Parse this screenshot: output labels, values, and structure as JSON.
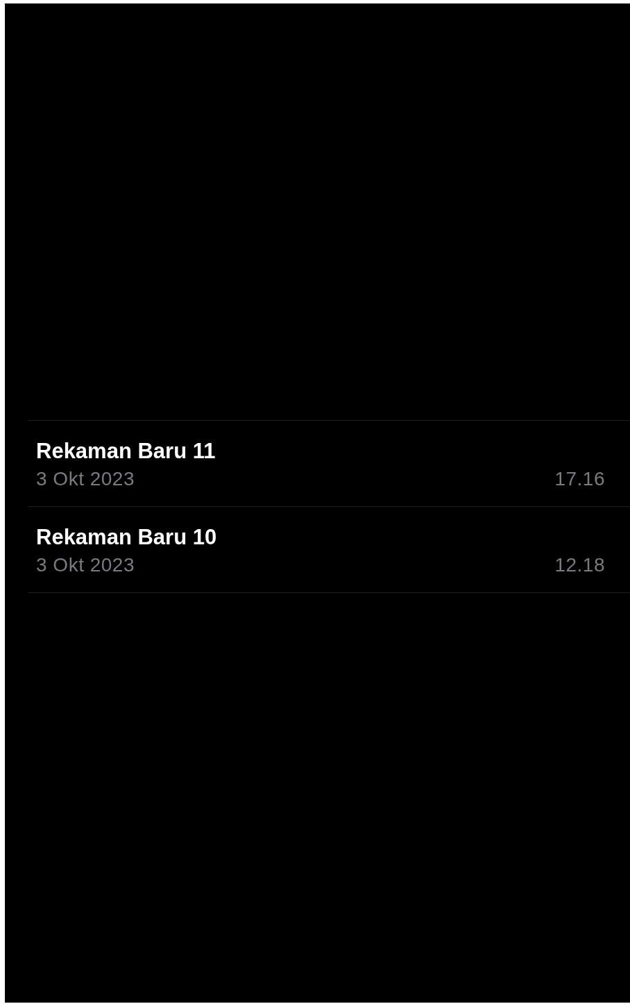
{
  "recordings": [
    {
      "title": "Rekaman Baru 11",
      "date": "3 Okt 2023",
      "duration": "17.16"
    },
    {
      "title": "Rekaman Baru 10",
      "date": "3 Okt 2023",
      "duration": "12.18"
    }
  ]
}
